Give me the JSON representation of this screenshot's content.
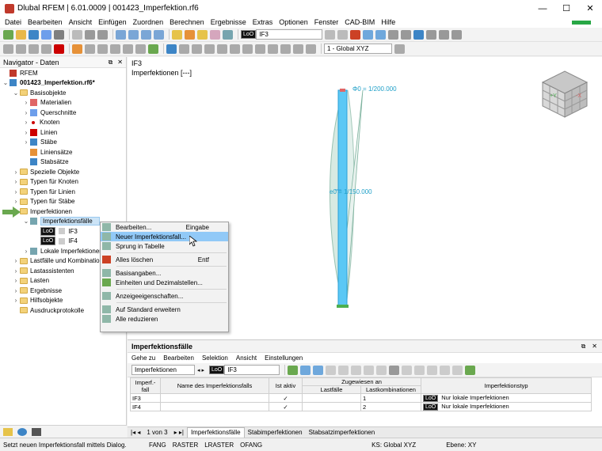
{
  "window": {
    "title": "Dlubal RFEM | 6.01.0009 | 001423_Imperfektion.rf6",
    "controls": [
      "—",
      "☐",
      "✕"
    ]
  },
  "menu": [
    "Datei",
    "Bearbeiten",
    "Ansicht",
    "Einfügen",
    "Zuordnen",
    "Berechnen",
    "Ergebnisse",
    "Extras",
    "Optionen",
    "Fenster",
    "CAD-BIM",
    "Hilfe"
  ],
  "toolbar": {
    "loo_badge": "LoO",
    "case_combo": "IF3",
    "coord_combo": "1 - Global XYZ"
  },
  "navigator": {
    "title": "Navigator - Daten",
    "tree": [
      {
        "label": "RFEM",
        "level": 0,
        "tw": "",
        "icon": "rfem"
      },
      {
        "label": "001423_Imperfektion.rf6*",
        "level": 0,
        "tw": "⌄",
        "icon": "model",
        "bold": true
      },
      {
        "label": "Basisobjekte",
        "level": 1,
        "tw": "⌄",
        "icon": "folder"
      },
      {
        "label": "Materialien",
        "level": 2,
        "tw": "›",
        "icon": "materials"
      },
      {
        "label": "Querschnitte",
        "level": 2,
        "tw": "›",
        "icon": "sections"
      },
      {
        "label": "Knoten",
        "level": 2,
        "tw": "›",
        "icon": "nodes"
      },
      {
        "label": "Linien",
        "level": 2,
        "tw": "›",
        "icon": "lines"
      },
      {
        "label": "Stäbe",
        "level": 2,
        "tw": "›",
        "icon": "members"
      },
      {
        "label": "Liniensätze",
        "level": 2,
        "tw": "",
        "icon": "linesets"
      },
      {
        "label": "Stabsätze",
        "level": 2,
        "tw": "",
        "icon": "membersets"
      },
      {
        "label": "Spezielle Objekte",
        "level": 1,
        "tw": "›",
        "icon": "folder"
      },
      {
        "label": "Typen für Knoten",
        "level": 1,
        "tw": "›",
        "icon": "folder"
      },
      {
        "label": "Typen für Linien",
        "level": 1,
        "tw": "›",
        "icon": "folder"
      },
      {
        "label": "Typen für Stäbe",
        "level": 1,
        "tw": "›",
        "icon": "folder"
      },
      {
        "label": "Imperfektionen",
        "level": 1,
        "tw": "⌄",
        "icon": "folder"
      },
      {
        "label": "Imperfektionsfälle",
        "level": 2,
        "tw": "⌄",
        "icon": "impcase",
        "selected": true
      },
      {
        "label": "IF3",
        "level": 3,
        "tw": "",
        "icon": "loo"
      },
      {
        "label": "IF4",
        "level": 3,
        "tw": "",
        "icon": "loo"
      },
      {
        "label": "Lokale Imperfektionen",
        "level": 2,
        "tw": "›",
        "icon": "localimp"
      },
      {
        "label": "Lastfälle und Kombinationen",
        "level": 1,
        "tw": "›",
        "icon": "folder"
      },
      {
        "label": "Lastassistenten",
        "level": 1,
        "tw": "›",
        "icon": "folder"
      },
      {
        "label": "Lasten",
        "level": 1,
        "tw": "›",
        "icon": "folder"
      },
      {
        "label": "Ergebnisse",
        "level": 1,
        "tw": "›",
        "icon": "folder"
      },
      {
        "label": "Hilfsobjekte",
        "level": 1,
        "tw": "›",
        "icon": "folder"
      },
      {
        "label": "Ausdruckprotokolle",
        "level": 1,
        "tw": "",
        "icon": "folder"
      }
    ]
  },
  "view": {
    "case_label": "IF3",
    "subtitle": "Imperfektionen [---]",
    "annotation_top": "Φ0 = 1/200.000",
    "annotation_mid": "e0 = 1/150.000",
    "cube_face_left": "+Y",
    "cube_face_right": "-X"
  },
  "context_menu": [
    {
      "label": "Bearbeiten...",
      "shortcut": "Eingabe",
      "icon": "edit-icon"
    },
    {
      "label": "Neuer Imperfektionsfall...",
      "shortcut": "",
      "icon": "new-imperfection-case-icon",
      "highlight": true
    },
    {
      "label": "Sprung in Tabelle",
      "shortcut": "",
      "icon": "jump-to-table-icon"
    },
    {
      "sep": true
    },
    {
      "label": "Alles löschen",
      "shortcut": "Entf",
      "icon": "delete-all-icon"
    },
    {
      "sep": true
    },
    {
      "label": "Basisangaben...",
      "shortcut": "",
      "icon": "base-data-icon"
    },
    {
      "label": "Einheiten und Dezimalstellen...",
      "shortcut": "",
      "icon": "units-icon"
    },
    {
      "sep": true
    },
    {
      "label": "Anzeigeeigenschaften...",
      "shortcut": "",
      "icon": "display-properties-icon"
    },
    {
      "sep": true
    },
    {
      "label": "Auf Standard erweitern",
      "shortcut": "",
      "icon": "expand-icon"
    },
    {
      "label": "Alle reduzieren",
      "shortcut": "",
      "icon": "collapse-icon"
    }
  ],
  "panel": {
    "title": "Imperfektionsfälle",
    "menu": [
      "Gehe zu",
      "Bearbeiten",
      "Selektion",
      "Ansicht",
      "Einstellungen"
    ],
    "combo_left": "Imperfektionen",
    "combo_case": "IF3",
    "table": {
      "group_header": "Zugewiesen an",
      "headers": [
        "Imperf.-fall",
        "Name des Imperfektionsfalls",
        "Ist aktiv",
        "Lastfälle",
        "Lastkombinationen",
        "Imperfektionstyp"
      ],
      "rows": [
        {
          "id": "IF3",
          "name": "",
          "active": "✓",
          "lastfaelle": "",
          "kombinationen": "1",
          "type_badge": "LoO",
          "type": "Nur lokale Imperfektionen"
        },
        {
          "id": "IF4",
          "name": "",
          "active": "✓",
          "lastfaelle": "",
          "kombinationen": "2",
          "type_badge": "LoO",
          "type": "Nur lokale Imperfektionen"
        }
      ]
    }
  },
  "tabs": {
    "pager": "1 von 3",
    "items": [
      "Imperfektionsfälle",
      "Stabimperfektionen",
      "Stabsatzimperfektionen"
    ],
    "active": 0
  },
  "status": {
    "message": "Setzt neuen Imperfektionsfall mittels Dialog.",
    "toggles": [
      "FANG",
      "RASTER",
      "LRASTER",
      "OFANG"
    ],
    "cs": "KS: Global XYZ",
    "plane": "Ebene: XY"
  },
  "colors": {
    "accent_green": "#28a745",
    "selection": "#cce4f7",
    "highlight": "#91c9f7",
    "member_blue": "#5bc8f5"
  }
}
